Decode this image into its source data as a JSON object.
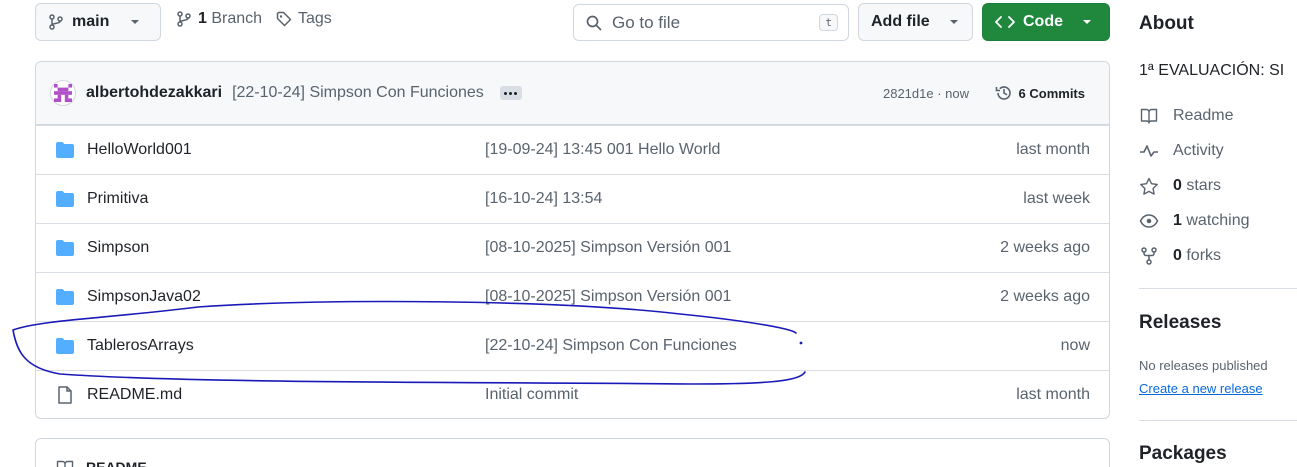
{
  "toolbar": {
    "branch": "main",
    "branches_count": "1",
    "branches_label": "Branch",
    "tags_label": "Tags",
    "search_placeholder": "Go to file",
    "search_shortcut": "t",
    "add_file_label": "Add file",
    "code_label": "Code"
  },
  "commit": {
    "author": "albertohdezakkari",
    "message": "[22-10-24] Simpson Con Funciones",
    "sha_time": "2821d1e · now",
    "commits_label": "6 Commits"
  },
  "files": [
    {
      "type": "folder",
      "name": "HelloWorld001",
      "message": "[19-09-24] 13:45 001 Hello World",
      "age": "last month"
    },
    {
      "type": "folder",
      "name": "Primitiva",
      "message": "[16-10-24] 13:54",
      "age": "last week"
    },
    {
      "type": "folder",
      "name": "Simpson",
      "message": "[08-10-2025] Simpson Versión 001",
      "age": "2 weeks ago"
    },
    {
      "type": "folder",
      "name": "SimpsonJava02",
      "message": "[08-10-2025] Simpson Versión 001",
      "age": "2 weeks ago"
    },
    {
      "type": "folder",
      "name": "TablerosArrays",
      "message": "[22-10-24] Simpson Con Funciones",
      "age": "now"
    },
    {
      "type": "file",
      "name": "README.md",
      "message": "Initial commit",
      "age": "last month"
    }
  ],
  "readme_tab": "README",
  "about": {
    "heading": "About",
    "description": "1ª EVALUACIÓN: SI",
    "readme": "Readme",
    "activity": "Activity",
    "stars_count": "0",
    "stars_label": "stars",
    "watching_count": "1",
    "watching_label": "watching",
    "forks_count": "0",
    "forks_label": "forks"
  },
  "releases": {
    "heading": "Releases",
    "none_text": "No releases published",
    "create_link": "Create a new release"
  },
  "packages": {
    "heading": "Packages"
  },
  "colors": {
    "accent": "#1f883d",
    "link": "#0969da",
    "folder": "#54aeff",
    "annotation": "#1a1ab8"
  },
  "icons": [
    "branch-icon",
    "tag-icon",
    "search-icon",
    "chevron-down-icon",
    "code-icon",
    "history-icon",
    "folder-icon",
    "file-icon",
    "book-icon",
    "pulse-icon",
    "star-icon",
    "eye-icon",
    "fork-icon"
  ]
}
